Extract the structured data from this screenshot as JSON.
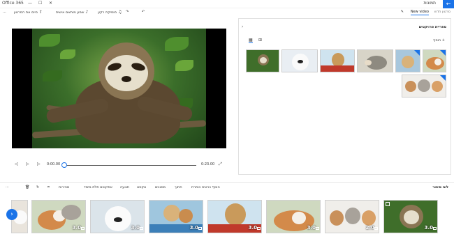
{
  "titlebar": {
    "app_title": "תמונות",
    "brand": "Office 365",
    "minimize": "—",
    "maximize": "☐",
    "close": "✕",
    "back_icon": "arrow-left-icon"
  },
  "toolbar": {
    "project_name": "סרטון חדש",
    "new_video": "New video",
    "undo_icon": "undo-icon",
    "redo_icon": "redo-icon",
    "background_music": "מוסיקת רקע",
    "custom_audio": "שמע מותאם אישית",
    "finish_video": "סיים את הסרטון",
    "more": "..."
  },
  "playback": {
    "current_time": "0:00.00",
    "total_time": "0:23.00"
  },
  "library": {
    "title": "ספריית פרויקטים",
    "add": "הוסף"
  },
  "storyboard": {
    "title": "לוח סיפור",
    "tools": {
      "add_title_card": "הוסף כרטיס כותרת",
      "trim": "חתוך",
      "split": "פיצול",
      "text": "טקסט",
      "motion": "תנועה",
      "filters": "מסננים",
      "effects_3d": "אפקטים תלת מימד",
      "speed": "מהירות"
    },
    "clips": [
      {
        "duration": "3.0"
      },
      {
        "duration": "2.0"
      },
      {
        "duration": "3.0"
      },
      {
        "duration": "3.0"
      },
      {
        "duration": "3.0"
      },
      {
        "duration": "3.0"
      },
      {
        "duration": "3.0"
      },
      {
        "duration": "3.0"
      }
    ]
  },
  "colors": {
    "accent": "#1a73e8"
  }
}
